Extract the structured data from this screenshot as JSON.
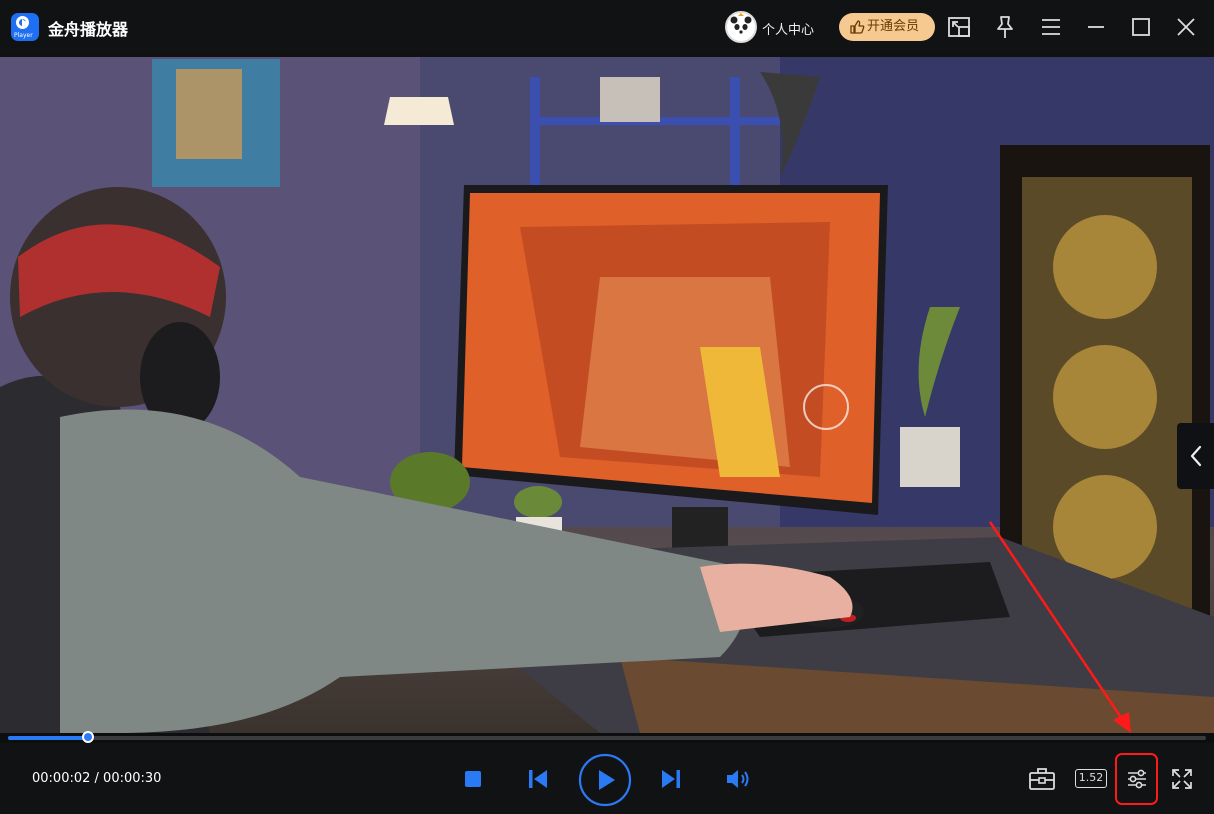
{
  "app": {
    "title": "金舟播放器",
    "logo_text": "Player",
    "accent_color": "#1f6ff2"
  },
  "header": {
    "user_center_label": "个人中心",
    "vip_button_label": "开通会员",
    "icons": [
      "avatar-panda",
      "picture-in-picture-icon",
      "pin-icon",
      "menu-icon",
      "minimize-icon",
      "maximize-icon",
      "close-icon"
    ]
  },
  "player": {
    "current_time": "00:00:02",
    "total_time": "00:00:30",
    "time_separator": " / ",
    "progress_fraction": 0.067,
    "speed_label": "1.52",
    "highlight_color": "#ff1a1a"
  },
  "controls": {
    "icons": [
      "stop-icon",
      "previous-icon",
      "play-icon",
      "next-icon",
      "volume-icon",
      "toolbox-icon",
      "speed-badge",
      "settings-sliders-icon",
      "fullscreen-icon"
    ]
  }
}
